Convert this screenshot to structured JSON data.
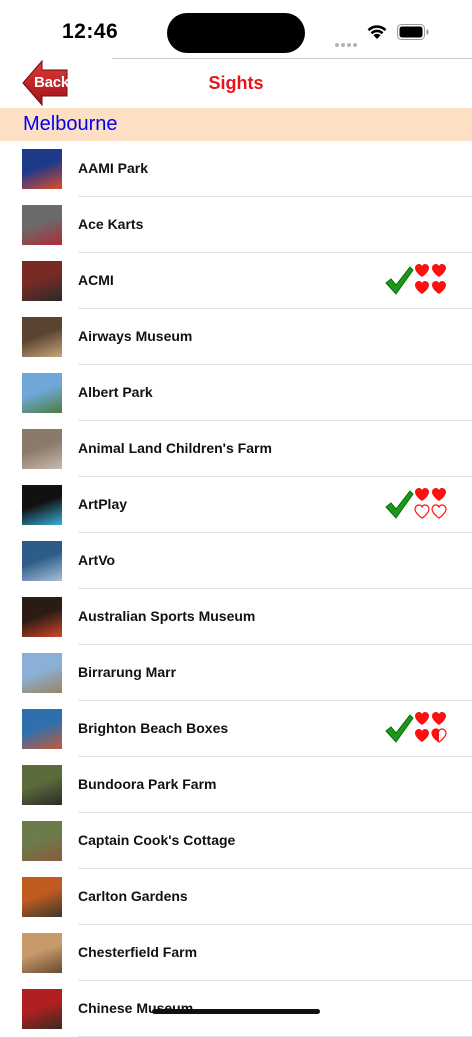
{
  "status_bar": {
    "time": "12:46"
  },
  "nav": {
    "back_label": "Back",
    "title": "Sights"
  },
  "section": {
    "title": "Melbourne"
  },
  "rows": [
    {
      "name": "AAMI Park",
      "thumb": [
        "#1d3a8a",
        "#e34a2a"
      ],
      "checked": false
    },
    {
      "name": "Ace Karts",
      "thumb": [
        "#6a6a6a",
        "#b02b35"
      ],
      "checked": false
    },
    {
      "name": "ACMI",
      "thumb": [
        "#7a2a24",
        "#2a2a2a"
      ],
      "checked": true,
      "hearts": [
        "full",
        "full",
        "full",
        "full"
      ]
    },
    {
      "name": "Airways Museum",
      "thumb": [
        "#5a4330",
        "#c7a679"
      ],
      "checked": false
    },
    {
      "name": "Albert Park",
      "thumb": [
        "#6fa8d8",
        "#4b7d3a"
      ],
      "checked": false
    },
    {
      "name": "Animal Land Children's Farm",
      "thumb": [
        "#8a7a6a",
        "#c9b9b0"
      ],
      "checked": false
    },
    {
      "name": "ArtPlay",
      "thumb": [
        "#111111",
        "#36b0d8"
      ],
      "checked": true,
      "hearts": [
        "full",
        "full",
        "empty",
        "empty"
      ]
    },
    {
      "name": "ArtVo",
      "thumb": [
        "#2d5c88",
        "#a9c0d8"
      ],
      "checked": false
    },
    {
      "name": "Australian Sports Museum",
      "thumb": [
        "#2a1c12",
        "#d0452a"
      ],
      "checked": false
    },
    {
      "name": "Birrarung Marr",
      "thumb": [
        "#8ab0d8",
        "#9c8360"
      ],
      "checked": false
    },
    {
      "name": "Brighton Beach Boxes",
      "thumb": [
        "#2f6fae",
        "#c35a3a"
      ],
      "checked": true,
      "hearts": [
        "full",
        "full",
        "full",
        "half"
      ]
    },
    {
      "name": "Bundoora Park Farm",
      "thumb": [
        "#5b6b3a",
        "#2b2b2b"
      ],
      "checked": false
    },
    {
      "name": "Captain Cook's Cottage",
      "thumb": [
        "#6b7c4a",
        "#8a5a3c"
      ],
      "checked": false
    },
    {
      "name": "Carlton Gardens",
      "thumb": [
        "#c05a20",
        "#3a3a2a"
      ],
      "checked": false
    },
    {
      "name": "Chesterfield Farm",
      "thumb": [
        "#c79a6a",
        "#6a4a30"
      ],
      "checked": false
    },
    {
      "name": "Chinese Museum",
      "thumb": [
        "#b02020",
        "#3a2a20"
      ],
      "checked": false
    }
  ]
}
